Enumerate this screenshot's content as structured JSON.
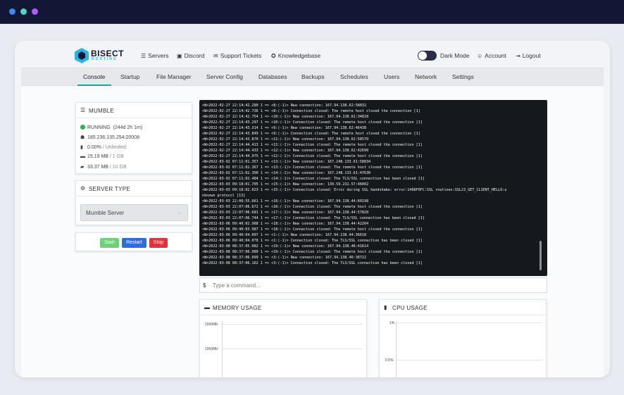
{
  "nav": {
    "brand_name": "BISECT",
    "brand_sub": "HOSTING",
    "links": [
      {
        "label": "Servers",
        "icon": "servers-icon"
      },
      {
        "label": "Discord",
        "icon": "discord-icon"
      },
      {
        "label": "Support Tickets",
        "icon": "support-icon"
      },
      {
        "label": "Knowledgebase",
        "icon": "knowledgebase-icon"
      }
    ],
    "dark_mode_label": "Dark Mode",
    "account_label": "Account",
    "logout_label": "Logout"
  },
  "tabs": [
    "Console",
    "Startup",
    "File Manager",
    "Server Config",
    "Databases",
    "Backups",
    "Schedules",
    "Users",
    "Network",
    "Settings"
  ],
  "active_tab": "Console",
  "server": {
    "name": "MUMBLE",
    "status": "RUNNING",
    "uptime": "(244d 2h 1m)",
    "address": "185.236.135.254:20008",
    "cpu_value": "0.00%",
    "cpu_limit": "/ Unlimited",
    "memory_value": "15.19 MB",
    "memory_limit": "/ 1 GB",
    "disk_value": "33.37 MB",
    "disk_limit": "/ 10 GB",
    "status_color": "#2ab24d"
  },
  "server_type": {
    "title": "SERVER TYPE",
    "selected": "Mumble Server"
  },
  "controls": {
    "start_label": "Start",
    "restart_label": "Restart",
    "stop_label": "Stop",
    "start_color": "#6fcf7a",
    "restart_color": "#2d6fd6",
    "stop_color": "#e0333b"
  },
  "console": {
    "lines": [
      "<W>2022-02-27 22:14:42.280 1 => <8:(-1)> New connection: 167.94.138.62:58832",
      "<W>2022-02-27 22:14:42.736 1 => <8:(-1)> Connection closed: The remote host closed the connection [1]",
      "<W>2022-02-27 22:14:42.754 1 => <10:(-1)> New connection: 167.94.138.62:34818",
      "<W>2022-02-27 22:14:43.297 1 => <10:(-1)> Connection closed: The remote host closed the connection [1]",
      "<W>2022-02-27 22:14:43.314 1 => <9:(-1)> New connection: 167.94.138.62:46438",
      "<W>2022-02-27 22:14:43.849 1 => <9:(-1)> Connection closed: The remote host closed the connection [1]",
      "<W>2022-02-27 22:14:43.870 1 => <11:(-1)> New connection: 167.94.138.62:58570",
      "<W>2022-02-27 22:14:44.413 1 => <11:(-1)> Connection closed: The remote host closed the connection [1]",
      "<W>2022-02-27 22:14:44.433 1 => <12:(-1)> New connection: 167.94.138.62:42690",
      "<W>2022-02-27 22:14:44.975 1 => <12:(-1)> Connection closed: The remote host closed the connection [1]",
      "<W>2022-03-02 07:11:01.357 1 => <13:(-1)> New connection: 167.248.133.61:58834",
      "<W>2022-03-02 07:11:02.367 1 => <13:(-1)> Connection closed: The remote host closed the connection [1]",
      "<W>2022-03-02 07:11:02.390 1 => <14:(-1)> New connection: 167.248.133.61:47630",
      "<W>2022-03-02 07:11:02.484 1 => <14:(-1)> Connection closed: The TLS/SSL connection has been closed [1]",
      "<W>2022-03-03 09:18:01.705 1 => <15:(-1)> New connection: 139.59.232.57:46002",
      "<W>2022-03-03 09:18:02.023 1 => <15:(-1)> Connection closed: Error during SSL handshake: error:1408F0FC:SSL routines:SSL23_GET_CLIENT_HELLO:u",
      "nknown protocol [13]",
      "<W>2022-03-03 22:06:55.661 1 => <16:(-1)> New connection: 167.94.138.44:60198",
      "<W>2022-03-03 22:07:06.672 1 => <16:(-1)> Connection closed: The remote host closed the connection [1]",
      "<W>2022-03-03 22:07:06.681 1 => <17:(-1)> New connection: 167.94.138.44:57820",
      "<W>2022-03-03 22:07:06.744 1 => <17:(-1)> Connection closed: The TLS/SSL connection has been closed [1]",
      "<W>2022-03-06 09:40:02.988 1 => <18:(-1)> New connection: 167.94.138.44:42264",
      "<W>2022-03-06 09:40:03.987 1 => <18:(-1)> Connection closed: The remote host closed the connection [1]",
      "<W>2022-03-06 09:40:04.007 1 => <1:(-1)> New connection: 167.94.138.44:36618",
      "<W>2022-03-06 09:40:04.078 1 => <1:(-1)> Connection closed: The TLS/SSL connection has been closed [1]",
      "<W>2022-03-08 08:37:05.082 1 => <19:(-1)> New connection: 167.94.138.46:41614",
      "<W>2022-03-08 08:37:06.080 1 => <19:(-1)> Connection closed: The remote host closed the connection [1]",
      "<W>2022-03-08 08:37:06.099 1 => <3:(-1)> New connection: 167.94.138.46:38722",
      "<W>2022-03-08 08:37:06.162 1 => <3:(-1)> Connection closed: The TLS/SSL connection has been closed [1]"
    ],
    "prompt": "$",
    "command_placeholder": "Type a command..."
  },
  "memory_chart": {
    "title": "MEMORY USAGE",
    "y_ticks": [
      "1500Mb",
      "1000Mb"
    ]
  },
  "cpu_chart": {
    "title": "CPU USAGE",
    "y_ticks": [
      "1%",
      "0.5%"
    ]
  }
}
